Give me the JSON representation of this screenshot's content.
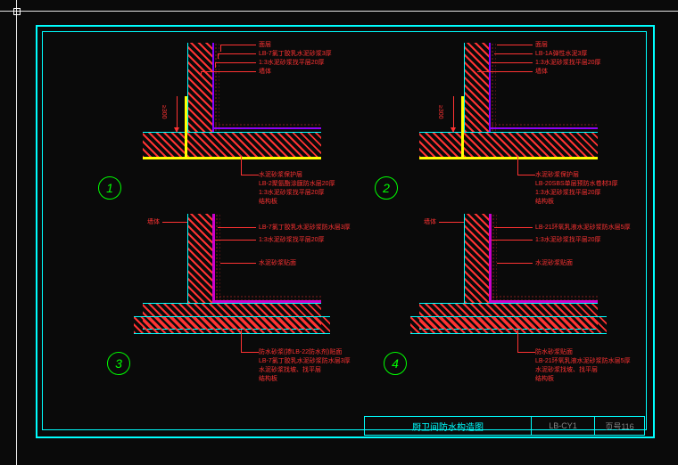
{
  "title_block": {
    "title": "厨卫间防水构造图",
    "code": "LB-CY1",
    "page": "页号116"
  },
  "details": [
    {
      "num": "1",
      "top_notes": [
        "面层",
        "LB-7氯丁胶乳水泥砂浆3厚",
        "1:3水泥砂浆找平层20厚",
        "墙体"
      ],
      "wall_label": "墙体",
      "dim_label": "≥300",
      "bottom_notes": [
        "水泥砂浆保护层",
        "LB-2聚氨酯涂膜防水层20厚",
        "1:3水泥砂浆找平层20厚",
        "结构板"
      ]
    },
    {
      "num": "2",
      "top_notes": [
        "面层",
        "LB-1A弹性水泥3厚",
        "1:3水泥砂浆找平层20厚",
        "墙体"
      ],
      "wall_label": "墙体",
      "dim_label": "≥300",
      "bottom_notes": [
        "水泥砂浆保护层",
        "LB-20SBS单层预防水卷材3厚",
        "1:3水泥砂浆找平层20厚",
        "结构板"
      ]
    },
    {
      "num": "3",
      "top_notes": [
        "LB-7氯丁胶乳水泥砂浆防水层3厚",
        "1:3水泥砂浆找平层20厚",
        "水泥砂浆贴面"
      ],
      "wall_label": "墙体",
      "bottom_notes": [
        "防水砂浆(掺LB-22防水剂)贴面",
        "LB-7氯丁胶乳水泥砂浆防水层3厚",
        "水泥砂浆找坡、找平层",
        "结构板"
      ]
    },
    {
      "num": "4",
      "top_notes": [
        "LB-21环氧乳液水泥砂浆防水层5厚",
        "1:3水泥砂浆找平层20厚",
        "水泥砂浆贴面"
      ],
      "wall_label": "墙体",
      "bottom_notes": [
        "防水砂浆贴面",
        "LB-21环氧乳液水泥砂浆防水层5厚",
        "水泥砂浆找坡、找平层",
        "结构板"
      ]
    }
  ]
}
